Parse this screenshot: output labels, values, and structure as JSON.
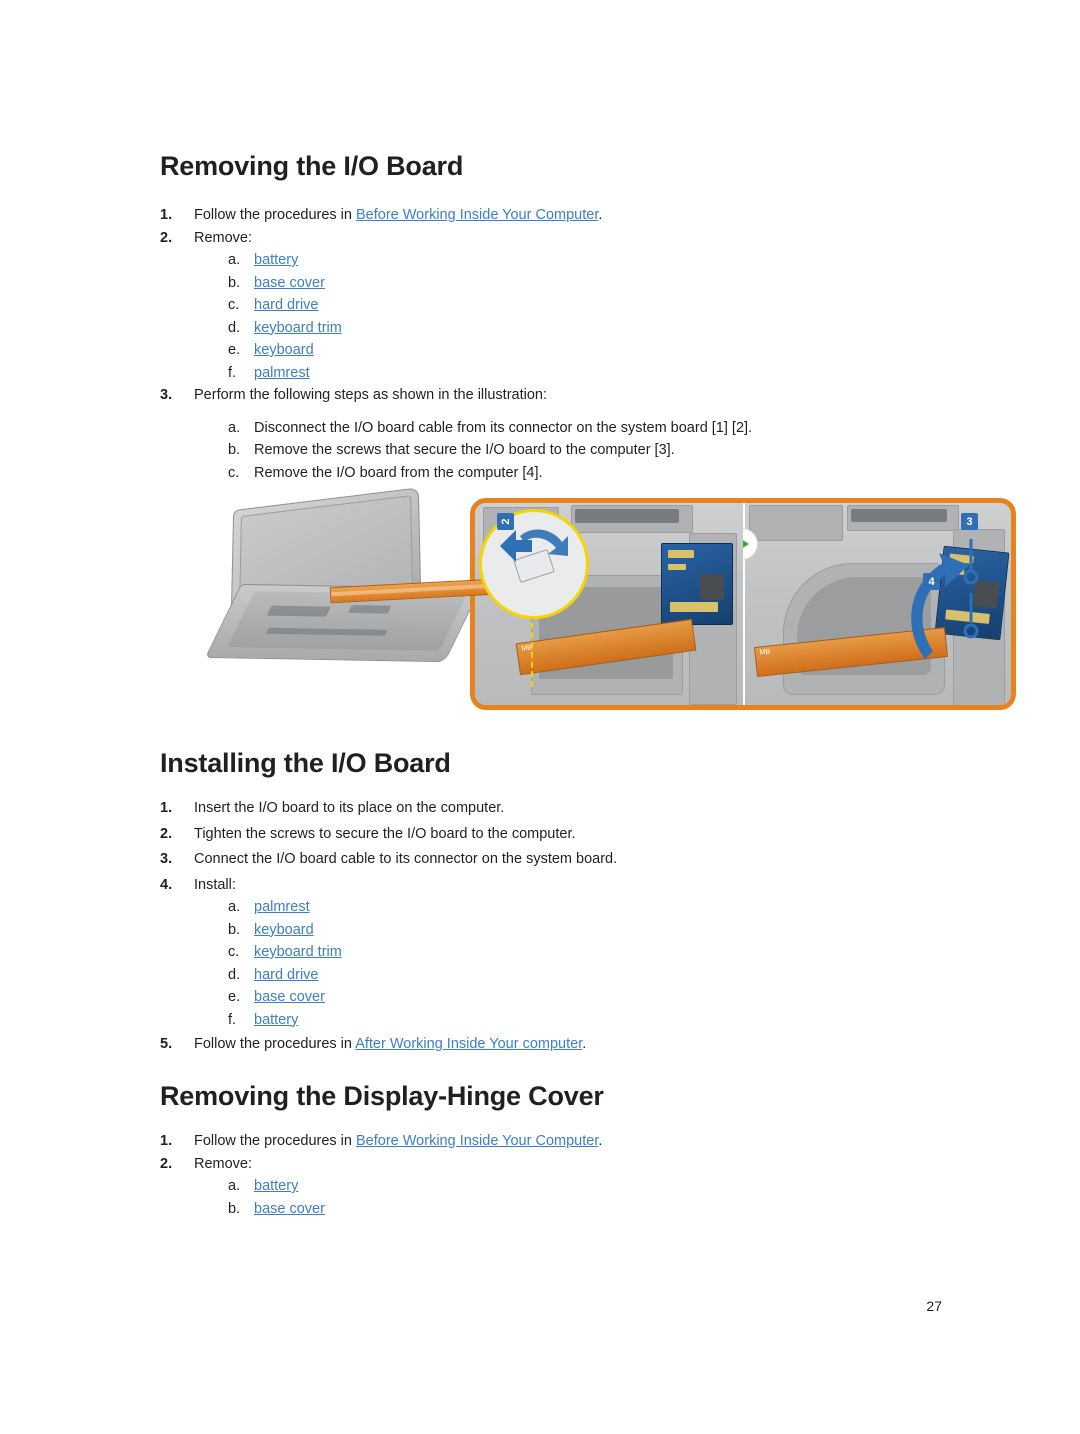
{
  "page": {
    "number": "27"
  },
  "sections": [
    {
      "id": "removing-io-board",
      "title": "Removing the I/O Board",
      "steps": [
        {
          "num": "1.",
          "text": "Follow the procedures in ",
          "link": "Before Working Inside Your Computer",
          "after": "."
        },
        {
          "num": "2.",
          "text": "Remove:"
        }
      ],
      "remove_list": [
        {
          "letter": "a.",
          "label": "battery"
        },
        {
          "letter": "b.",
          "label": "base cover"
        },
        {
          "letter": "c.",
          "label": "hard drive"
        },
        {
          "letter": "d.",
          "label": "keyboard trim"
        },
        {
          "letter": "e.",
          "label": "keyboard"
        },
        {
          "letter": "f.",
          "label": "palmrest"
        }
      ],
      "step3": {
        "num": "3.",
        "text": "Perform the following steps as shown in the illustration:"
      },
      "step3_list": [
        {
          "letter": "a.",
          "label": "Disconnect the I/O board cable from its connector on the system board [1] [2]."
        },
        {
          "letter": "b.",
          "label": "Remove the screws that secure the I/O board to the computer [3]."
        },
        {
          "letter": "c.",
          "label": "Remove the I/O board from the computer [4]."
        }
      ]
    },
    {
      "id": "installing-io-board",
      "title": "Installing the I/O Board",
      "steps": [
        {
          "num": "1.",
          "text": "Insert the I/O board to its place on the computer."
        },
        {
          "num": "2.",
          "text": "Tighten the screws to secure the I/O board to the computer."
        },
        {
          "num": "3.",
          "text": "Connect the I/O board cable to its connector on the system board."
        },
        {
          "num": "4.",
          "text": "Install:"
        }
      ],
      "install_list": [
        {
          "letter": "a.",
          "label": "palmrest"
        },
        {
          "letter": "b.",
          "label": "keyboard"
        },
        {
          "letter": "c.",
          "label": "keyboard trim"
        },
        {
          "letter": "d.",
          "label": "hard drive"
        },
        {
          "letter": "e.",
          "label": "base cover"
        },
        {
          "letter": "f.",
          "label": "battery"
        }
      ],
      "step5": {
        "num": "5.",
        "text": "Follow the procedures in ",
        "link": "After Working Inside Your computer",
        "after": "."
      }
    },
    {
      "id": "removing-display-hinge-cover",
      "title": "Removing the Display-Hinge Cover",
      "steps": [
        {
          "num": "1.",
          "text": "Follow the procedures in ",
          "link": "Before Working Inside Your Computer",
          "after": "."
        },
        {
          "num": "2.",
          "text": "Remove:"
        }
      ],
      "remove_list": [
        {
          "letter": "a.",
          "label": "battery"
        },
        {
          "letter": "b.",
          "label": "base cover"
        }
      ]
    }
  ],
  "illustration": {
    "callout_labels": [
      "2",
      "3",
      "4"
    ],
    "cable_text_left": "MB",
    "cable_text_right": "MB",
    "play_icon": "play-icon",
    "frame_color": "#e8821e",
    "callout_ring_color": "#f5d400",
    "badge_color": "#2f6fb5"
  }
}
